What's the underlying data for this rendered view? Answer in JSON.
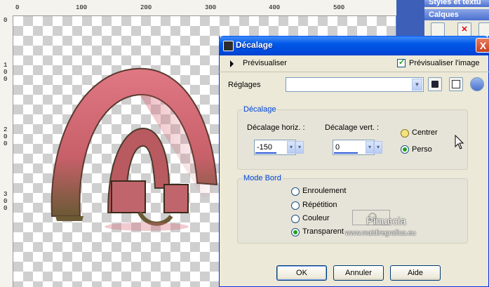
{
  "palettes": {
    "styles_title": "Styles et textu",
    "layers_title": "Calques"
  },
  "rulers": {
    "top_labels": [
      "0",
      "100",
      "200",
      "300",
      "400",
      "500"
    ],
    "left_labels": [
      "0",
      "100",
      "200",
      "300"
    ]
  },
  "dialog": {
    "title": "Décalage",
    "close_label": "X",
    "preview_label": "Prévisualiser",
    "preview_image_label": "Prévisualiser l'image",
    "preview_image_checked": true,
    "settings_label": "Réglages",
    "settings_value": "",
    "offset_group": {
      "title": "Décalage",
      "horiz_label": "Décalage horiz. :",
      "horiz_value": "-150",
      "vert_label": "Décalage vert. :",
      "vert_value": "0",
      "center_label": "Centrer",
      "custom_label": "Perso",
      "selected": "Perso"
    },
    "edge_group": {
      "title": "Mode Bord",
      "options": [
        "Enroulement",
        "Répétition",
        "Couleur",
        "Transparent"
      ],
      "selected": "Transparent"
    },
    "buttons": {
      "ok": "OK",
      "cancel": "Annuler",
      "help": "Aide"
    }
  },
  "watermark": {
    "name": "Pinuccia",
    "site": "www.maidiregrafica.eu"
  },
  "colors": {
    "titlebar": "#0058e7",
    "group_title": "#0046d5",
    "arch_pink": "#d86a78",
    "arch_brown": "#5a4a2a"
  }
}
